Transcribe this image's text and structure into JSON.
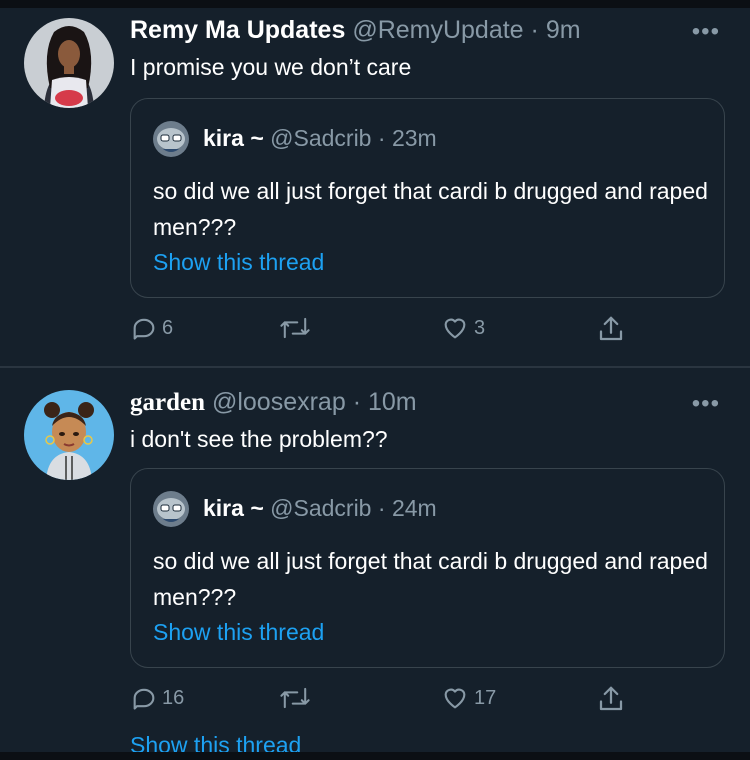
{
  "tweets": [
    {
      "name": "Remy Ma Updates",
      "handle": "@RemyUpdate",
      "time": "9m",
      "text": "I promise you we don’t care",
      "quote": {
        "name": "kira ~",
        "handle": "@Sadcrib",
        "time": "23m",
        "text": "so did we all just forget that cardi b drugged and raped men???",
        "link": "Show this thread"
      },
      "replies": "6",
      "retweets": "",
      "likes": "3"
    },
    {
      "name": "garden",
      "handle": "@loosexrap",
      "time": "10m",
      "text": "i don't see the problem??",
      "quote": {
        "name": "kira ~",
        "handle": "@Sadcrib",
        "time": "24m",
        "text": "so did we all just forget that cardi b drugged and raped men???",
        "link": "Show this thread"
      },
      "replies": "16",
      "retweets": "",
      "likes": "17",
      "show_thread": "Show this thread"
    }
  ],
  "separator": "·",
  "more_icon": "more-horizontal-icon",
  "colors": {
    "background": "#15202b",
    "secondary_text": "#8899a6",
    "link": "#1da1f2",
    "border": "#38444d"
  }
}
